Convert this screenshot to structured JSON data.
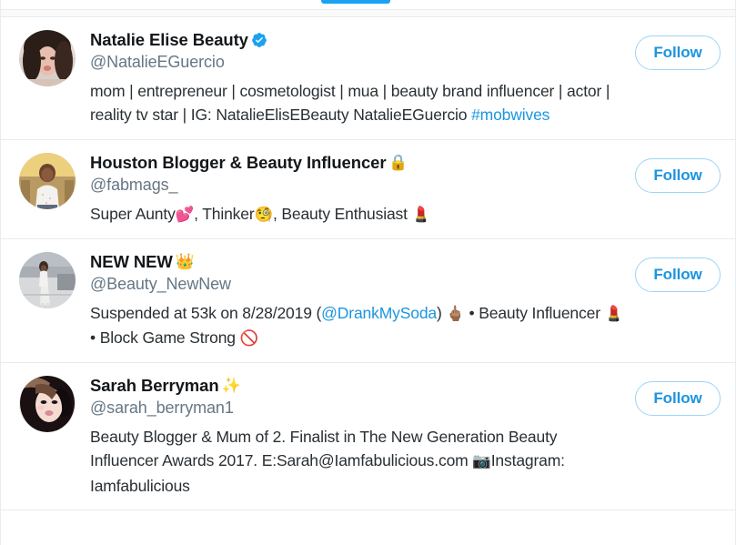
{
  "tabstrip": {
    "active_tab_indicator_color": "#1da1f2"
  },
  "colors": {
    "accent": "#1da1f2",
    "link": "#1b95e0",
    "name": "#14171a",
    "handle": "#657786",
    "bio": "#292f33",
    "border": "#e6ecf0",
    "follow_border": "#9fd4f5"
  },
  "follow_label": "Follow",
  "users": [
    {
      "display_name": "Natalie Elise Beauty",
      "badge": "verified-badge",
      "handle": "@NatalieEGuercio",
      "bio_parts": [
        {
          "type": "text",
          "text": "mom | entrepreneur | cosmetologist | mua | beauty brand influencer | actor | reality tv star | IG: NatalieElisEBeauty NatalieEGuercio "
        },
        {
          "type": "link",
          "text": "#mobwives"
        }
      ],
      "bio_plain": "mom | entrepreneur | cosmetologist | mua | beauty brand influencer | actor | reality tv star | IG: NatalieElisEBeauty NatalieEGuercio #mobwives",
      "follow_label": "Follow",
      "avatar": "natalie-elise-beauty-avatar"
    },
    {
      "display_name": "Houston Blogger & Beauty Influencer",
      "badge": "protected-lock-icon",
      "badge_emoji": "🔒",
      "handle": "@fabmags_",
      "bio_parts": [
        {
          "type": "text",
          "text": "Super Aunty"
        },
        {
          "type": "emoji",
          "text": "💕"
        },
        {
          "type": "text",
          "text": ", Thinker"
        },
        {
          "type": "emoji",
          "text": "🧐"
        },
        {
          "type": "text",
          "text": ", Beauty Enthusiast "
        },
        {
          "type": "emoji",
          "text": "💄"
        }
      ],
      "bio_plain": "Super Aunty💕, Thinker🧐, Beauty Enthusiast 💄",
      "follow_label": "Follow",
      "avatar": "fabmags-avatar"
    },
    {
      "display_name": "NEW NEW",
      "badge": "crown-emoji",
      "badge_emoji": "👑",
      "handle": "@Beauty_NewNew",
      "bio_parts": [
        {
          "type": "text",
          "text": "Suspended at 53k on 8/28/2019 ("
        },
        {
          "type": "link",
          "text": "@DrankMySoda"
        },
        {
          "type": "text",
          "text": ") "
        },
        {
          "type": "emoji",
          "text": "🖕🏽"
        },
        {
          "type": "text",
          "text": " • Beauty Influencer "
        },
        {
          "type": "emoji",
          "text": "💄"
        },
        {
          "type": "text",
          "text": " • Block Game Strong "
        },
        {
          "type": "emoji",
          "text": "🚫"
        }
      ],
      "bio_plain": "Suspended at 53k on 8/28/2019 (@DrankMySoda) 🖕🏽 • Beauty Influencer 💄 • Block Game Strong 🚫",
      "follow_label": "Follow",
      "avatar": "beauty-newnew-avatar"
    },
    {
      "display_name": "Sarah Berryman",
      "badge": "sparkles-emoji",
      "badge_emoji": "✨",
      "handle": "@sarah_berryman1",
      "bio_parts": [
        {
          "type": "text",
          "text": "Beauty Blogger & Mum of 2. Finalist in The New Generation Beauty Influencer Awards 2017. E:Sarah@Iamfabulicious.com "
        },
        {
          "type": "emoji",
          "text": "📷"
        },
        {
          "type": "text",
          "text": "Instagram: Iamfabulicious"
        }
      ],
      "bio_plain": "Beauty Blogger & Mum of 2. Finalist in The New Generation Beauty Influencer Awards 2017. E:Sarah@Iamfabulicious.com 📷Instagram: Iamfabulicious",
      "follow_label": "Follow",
      "avatar": "sarah-berryman-avatar"
    }
  ]
}
